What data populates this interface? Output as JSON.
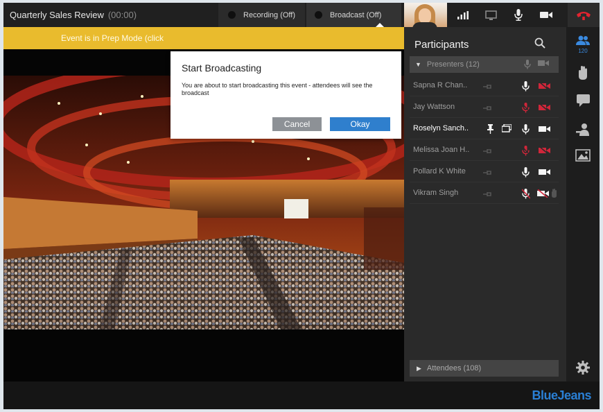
{
  "meeting": {
    "title": "Quarterly Sales Review",
    "timer": "(00:00)"
  },
  "toolbar": {
    "recording_label": "Recording (Off)",
    "broadcast_label": "Broadcast (Off)",
    "icons": [
      "signal-icon",
      "screen-share-icon",
      "microphone-icon",
      "camera-icon",
      "end-call-icon"
    ]
  },
  "banner": {
    "text": "Event is in Prep Mode (click"
  },
  "dialog": {
    "title": "Start Broadcasting",
    "body": "You are about to start broadcasting this event - attendees will see the broadcast",
    "cancel_label": "Cancel",
    "okay_label": "Okay"
  },
  "participants": {
    "title": "Participants",
    "presenters_label": "Presenters (12)",
    "attendees_label": "Attendees (108)",
    "rows": [
      {
        "name": "Sapna R Chan..",
        "mic": "on",
        "video": "muted"
      },
      {
        "name": "Jay Wattson",
        "mic": "muted",
        "video": "muted"
      },
      {
        "name": "Roselyn Sanch..",
        "mic": "on",
        "video": "on",
        "pinned": true,
        "sharing": true
      },
      {
        "name": "Melissa Joan H..",
        "mic": "muted",
        "video": "muted"
      },
      {
        "name": "Pollard K White",
        "mic": "on",
        "video": "on"
      },
      {
        "name": "Vikram Singh",
        "mic": "muted-self",
        "video": "off-self",
        "hand_raised": true
      }
    ]
  },
  "rail": {
    "participants_count": "120"
  },
  "brand": {
    "name": "BlueJeans"
  },
  "colors": {
    "accent": "#2f7fcd",
    "banner": "#e9bb2d",
    "muted_red": "#d0263a",
    "brand": "#2a7fd4"
  }
}
